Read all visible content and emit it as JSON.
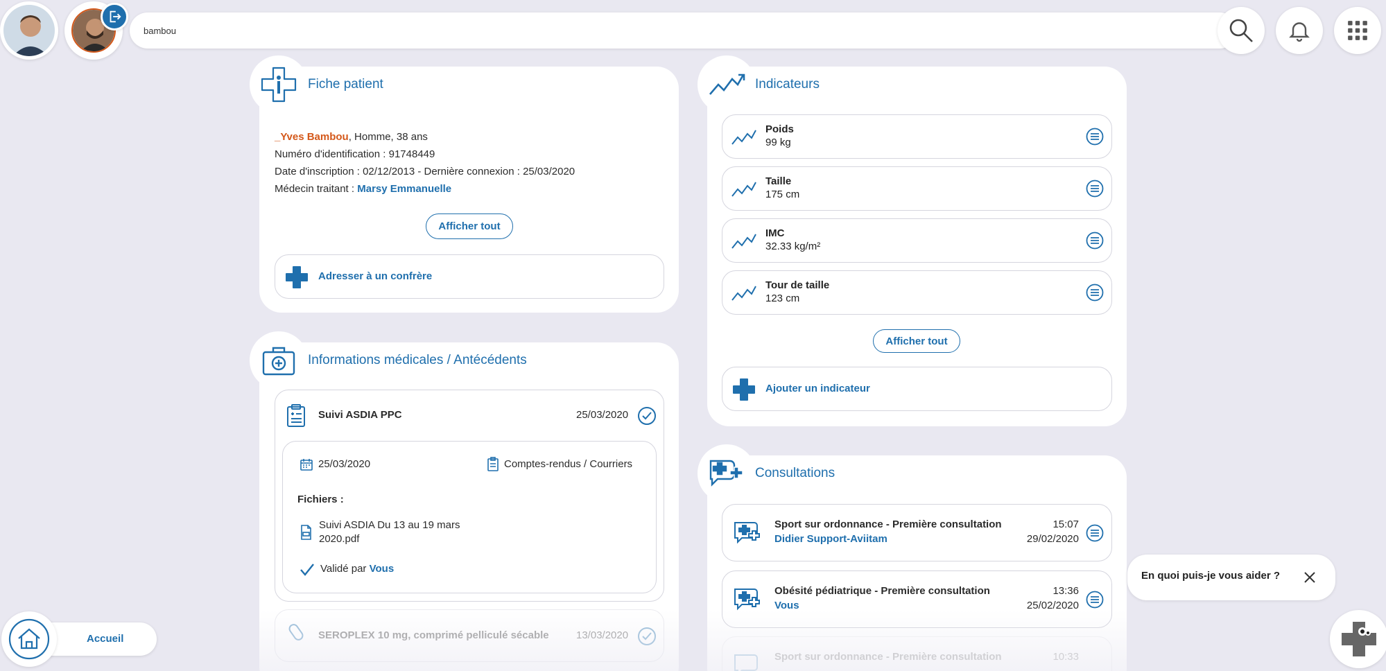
{
  "search": {
    "value": "bambou"
  },
  "patient_card": {
    "title": "Fiche patient",
    "name": "_Yves Bambou",
    "name_suffix": ", Homme, 38 ans",
    "id_line": "Numéro d'identification : 91748449",
    "dates_line": "Date d'inscription : 02/12/2013 - Dernière connexion : 25/03/2020",
    "doctor_label": "Médecin traitant : ",
    "doctor_name": "Marsy Emmanuelle",
    "show_all": "Afficher tout",
    "refer": "Adresser à un confrère"
  },
  "medical": {
    "title": "Informations médicales / Antécédents",
    "entry1": {
      "title": "Suivi ASDIA PPC",
      "date": "25/03/2020",
      "detail_date": "25/03/2020",
      "category": "Comptes-rendus / Courriers",
      "files_label": "Fichiers :",
      "file_line1": "Suivi ASDIA Du 13 au 19 mars",
      "file_line2": "2020.pdf",
      "validated_label": "Validé par ",
      "validated_by": "Vous"
    },
    "entry2": {
      "title": "SEROPLEX 10 mg, comprimé pelliculé sécable",
      "date": "13/03/2020"
    }
  },
  "indicators": {
    "title": "Indicateurs",
    "items": [
      {
        "name": "Poids",
        "value": "99 kg"
      },
      {
        "name": "Taille",
        "value": "175 cm"
      },
      {
        "name": "IMC",
        "value": "32.33 kg/m²"
      },
      {
        "name": "Tour de taille",
        "value": "123 cm"
      }
    ],
    "show_all": "Afficher tout",
    "add": "Ajouter un indicateur"
  },
  "consultations": {
    "title": "Consultations",
    "items": [
      {
        "title": "Sport sur ordonnance - Première consultation",
        "who": "Didier Support-Aviitam",
        "time": "15:07",
        "date": "29/02/2020"
      },
      {
        "title": "Obésité pédiatrique - Première consultation",
        "who": "Vous",
        "time": "13:36",
        "date": "25/02/2020"
      },
      {
        "title": "Sport sur ordonnance - Première consultation",
        "time": "10:33"
      }
    ]
  },
  "chat": {
    "question": "En quoi puis-je vous aider ?"
  },
  "home": {
    "label": "Accueil"
  },
  "colors": {
    "accent": "#1f6fad",
    "patient_name": "#d4581a",
    "background": "#e9e8f1"
  }
}
